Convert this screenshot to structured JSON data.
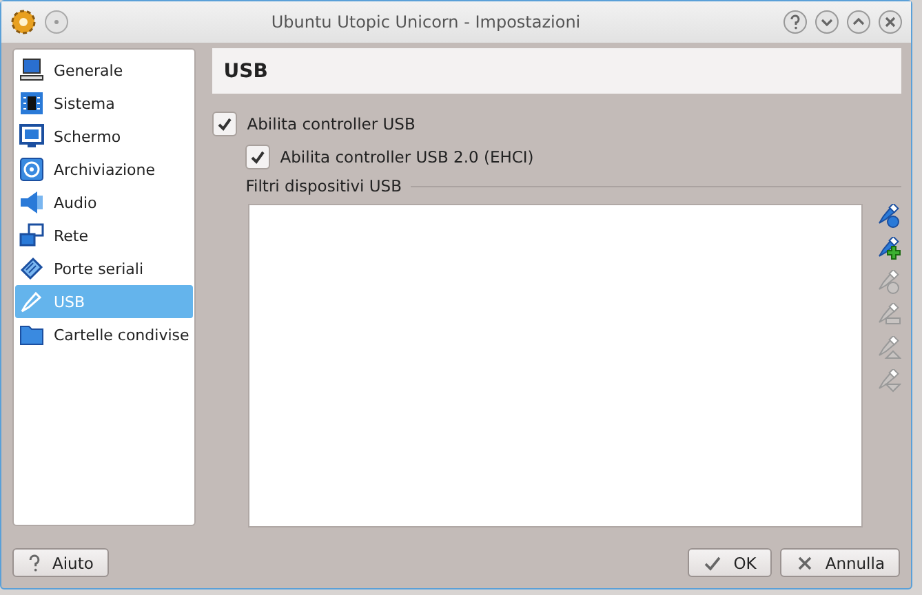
{
  "window": {
    "title": "Ubuntu Utopic Unicorn - Impostazioni"
  },
  "sidebar": {
    "items": [
      {
        "label": "Generale",
        "kind": "monitor-desk",
        "selected": false
      },
      {
        "label": "Sistema",
        "kind": "chip",
        "selected": false
      },
      {
        "label": "Schermo",
        "kind": "monitor",
        "selected": false
      },
      {
        "label": "Archiviazione",
        "kind": "disk",
        "selected": false
      },
      {
        "label": "Audio",
        "kind": "speaker",
        "selected": false
      },
      {
        "label": "Rete",
        "kind": "network",
        "selected": false
      },
      {
        "label": "Porte seriali",
        "kind": "serial",
        "selected": false
      },
      {
        "label": "USB",
        "kind": "usb",
        "selected": true
      },
      {
        "label": "Cartelle condivise",
        "kind": "folder",
        "selected": false
      }
    ]
  },
  "page": {
    "title": "USB",
    "options": [
      {
        "label": "Abilita controller USB",
        "checked": true,
        "nested": false
      },
      {
        "label": "Abilita controller USB 2.0 (EHCI)",
        "checked": true,
        "nested": true
      }
    ],
    "filters_label": "Filtri dispositivi USB",
    "filter_tools": [
      {
        "kind": "dot",
        "disabled": false
      },
      {
        "kind": "plus",
        "disabled": false
      },
      {
        "kind": "dot",
        "disabled": true
      },
      {
        "kind": "bar",
        "disabled": true
      },
      {
        "kind": "up",
        "disabled": true
      },
      {
        "kind": "down",
        "disabled": true
      }
    ]
  },
  "buttons": [
    {
      "label": "Aiuto",
      "kind": "help"
    },
    {
      "label": "OK",
      "kind": "ok"
    },
    {
      "label": "Annulla",
      "kind": "cancel"
    }
  ]
}
